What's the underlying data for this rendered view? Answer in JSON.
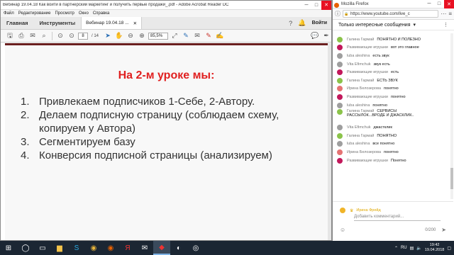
{
  "acrobat": {
    "title": "Вебинар 19.04.18 Как войти в партнерский маркетинг и получить первые продажи_.pdf - Adobe Acrobat Reader DC",
    "menu": [
      "Файл",
      "Редактирование",
      "Просмотр",
      "Окно",
      "Справка"
    ],
    "tabs": {
      "home": "Главная",
      "tools": "Инструменты",
      "doc": "Вебинар 19.04.18 ...",
      "login": "Войти"
    },
    "toolbar": {
      "page_current": "8",
      "page_total": "/ 14",
      "zoom": "85,5%"
    },
    "slide": {
      "title": "На 2-м уроке мы:",
      "items": [
        {
          "num": "1.",
          "text": "Привлекаем подписчиков 1-Себе, 2-Автору."
        },
        {
          "num": "2.",
          "text": "Делаем подписную страницу (соблюдаем схему, копируем у Автора)"
        },
        {
          "num": "3.",
          "text": "Сегментируем базу"
        },
        {
          "num": "4.",
          "text": "Конверсия подписной страницы (анализируем)"
        }
      ]
    }
  },
  "firefox": {
    "title": "Mozilla Firefox",
    "url": "https://www.youtube.com/live_c",
    "chat_header": "Только интересные сообщения",
    "messages": [
      {
        "author": "Галина Гармай",
        "text": "ПОНЯТНО И ПОЛЕЗНО",
        "color": "#8bc34a"
      },
      {
        "author": "Развивающие игрушки",
        "text": "вот это главное",
        "color": "#c2185b"
      },
      {
        "author": "luba aleshina",
        "text": "есть звук",
        "color": "#9e9e9e"
      },
      {
        "author": "Vita Efimchuk",
        "text": "звук есть",
        "color": "#9e9e9e"
      },
      {
        "author": "Развивающие игрушки",
        "text": "есть",
        "color": "#c2185b"
      },
      {
        "author": "Галина Гармай",
        "text": "ЕСТЬ ЗВУК",
        "color": "#8bc34a"
      },
      {
        "author": "Ирина Белозерова",
        "text": "понятно",
        "color": "#e57373"
      },
      {
        "author": "Развивающие игрушки",
        "text": "понятно",
        "color": "#c2185b"
      },
      {
        "author": "luba aleshina",
        "text": "понятно",
        "color": "#9e9e9e"
      },
      {
        "author": "Галина Гармай",
        "text": "СЕРВИСЫ",
        "text2": "РАССЫЛОК...ВРОДЕ И ДЖАСКЛИК..",
        "color": "#8bc34a"
      },
      {
        "author": "Vita Efimchuk",
        "text": "джастклик",
        "color": "#9e9e9e"
      },
      {
        "author": "Галина Гармай",
        "text": "ПОНЯТНО",
        "color": "#8bc34a"
      },
      {
        "author": "luba aleshina",
        "text": "все понятно",
        "color": "#9e9e9e"
      },
      {
        "author": "Ирина Белозерова",
        "text": "понятно",
        "color": "#e57373"
      },
      {
        "author": "Развивающие игрушки",
        "text": "Понятно",
        "color": "#c2185b"
      }
    ],
    "input": {
      "user": "Ирина Фрейд",
      "placeholder": "Добавить комментарий...",
      "counter": "0/200"
    }
  },
  "taskbar": {
    "lang": "RU",
    "time": "19:42",
    "date": "19.04.2018"
  }
}
